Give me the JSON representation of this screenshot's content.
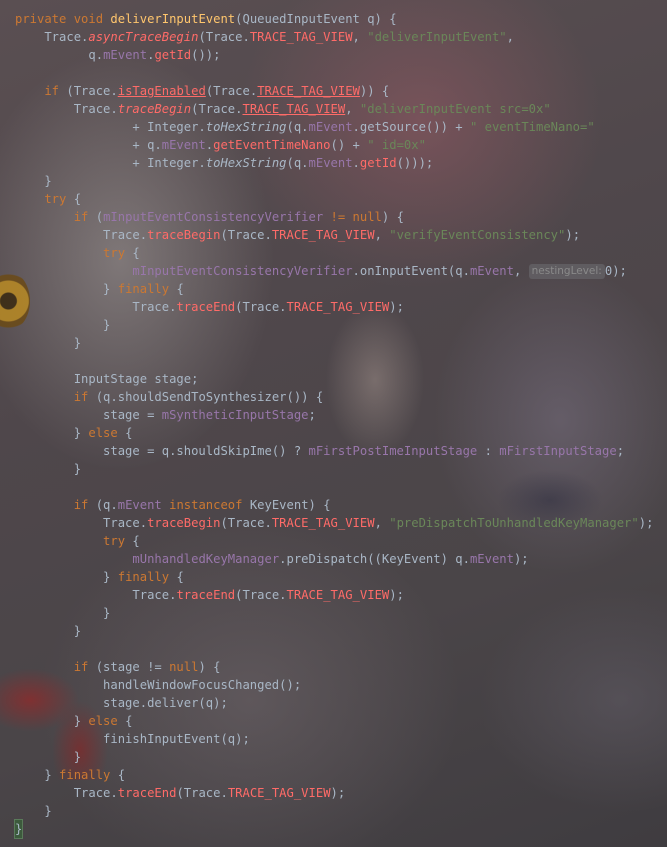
{
  "editor": {
    "language": "java",
    "theme_colors": {
      "default": "#a9b7c6",
      "keyword": "#cc7832",
      "method_declaration": "#ffc66d",
      "field": "#9876aa",
      "static_member": "#ff6b68",
      "string": "#6a8759",
      "inlay_hint": "#8a8a8a"
    },
    "lines": [
      [
        [
          "kw",
          "private void "
        ],
        [
          "mfn",
          "deliverInputEvent"
        ],
        [
          "",
          "(QueuedInputEvent q) {"
        ]
      ],
      [
        [
          "",
          "    Trace."
        ],
        [
          "sm it",
          "asyncTraceBegin"
        ],
        [
          "",
          "(Trace."
        ],
        [
          "sm",
          "TRACE_TAG_VIEW"
        ],
        [
          "",
          ", "
        ],
        [
          "str",
          "\"deliverInputEvent\""
        ],
        [
          "",
          ","
        ]
      ],
      [
        [
          "",
          "          q."
        ],
        [
          "fld",
          "mEvent"
        ],
        [
          "",
          "."
        ],
        [
          "sm",
          "getId"
        ],
        [
          "",
          "());"
        ]
      ],
      [
        [
          "",
          ""
        ]
      ],
      [
        [
          "kw",
          "    if "
        ],
        [
          "",
          "(Trace."
        ],
        [
          "sm ul",
          "isTagEnabled"
        ],
        [
          "",
          "(Trace."
        ],
        [
          "sm ul",
          "TRACE_TAG_VIEW"
        ],
        [
          "",
          ")) {"
        ]
      ],
      [
        [
          "",
          "        Trace."
        ],
        [
          "sm it",
          "traceBegin"
        ],
        [
          "",
          "(Trace."
        ],
        [
          "sm ul",
          "TRACE_TAG_VIEW"
        ],
        [
          "",
          ", "
        ],
        [
          "str",
          "\"deliverInputEvent src=0x\""
        ]
      ],
      [
        [
          "",
          "                + Integer."
        ],
        [
          "it",
          "toHexString"
        ],
        [
          "",
          "(q."
        ],
        [
          "fld",
          "mEvent"
        ],
        [
          "",
          ".getSource()) + "
        ],
        [
          "str",
          "\" eventTimeNano=\""
        ]
      ],
      [
        [
          "",
          "                + q."
        ],
        [
          "fld",
          "mEvent"
        ],
        [
          "",
          "."
        ],
        [
          "sm",
          "getEventTimeNano"
        ],
        [
          "",
          "() + "
        ],
        [
          "str",
          "\" id=0x\""
        ]
      ],
      [
        [
          "",
          "                + Integer."
        ],
        [
          "it",
          "toHexString"
        ],
        [
          "",
          "(q."
        ],
        [
          "fld",
          "mEvent"
        ],
        [
          "",
          "."
        ],
        [
          "sm",
          "getId"
        ],
        [
          "",
          "()));"
        ]
      ],
      [
        [
          "",
          "    }"
        ]
      ],
      [
        [
          "kw",
          "    try "
        ],
        [
          "",
          "{"
        ]
      ],
      [
        [
          "kw",
          "        if "
        ],
        [
          "",
          "("
        ],
        [
          "fld",
          "mInputEventConsistencyVerifier"
        ],
        [
          "",
          ""
        ],
        [
          "kw",
          " != null"
        ],
        [
          "",
          ") {"
        ]
      ],
      [
        [
          "",
          "            Trace."
        ],
        [
          "sm",
          "traceBegin"
        ],
        [
          "",
          "(Trace."
        ],
        [
          "sm",
          "TRACE_TAG_VIEW"
        ],
        [
          "",
          ", "
        ],
        [
          "str",
          "\"verifyEventConsistency\""
        ],
        [
          "",
          ");"
        ]
      ],
      [
        [
          "kw",
          "            try "
        ],
        [
          "",
          "{"
        ]
      ],
      [
        [
          "",
          "                "
        ],
        [
          "fld",
          "mInputEventConsistencyVerifier"
        ],
        [
          "",
          ".onInputEvent(q."
        ],
        [
          "fld",
          "mEvent"
        ],
        [
          "",
          ", "
        ],
        [
          "hint",
          "nestingLevel:"
        ],
        [
          "",
          "0);"
        ]
      ],
      [
        [
          "",
          "            } "
        ],
        [
          "kw",
          "finally "
        ],
        [
          "",
          "{"
        ]
      ],
      [
        [
          "",
          "                Trace."
        ],
        [
          "sm",
          "traceEnd"
        ],
        [
          "",
          "(Trace."
        ],
        [
          "sm",
          "TRACE_TAG_VIEW"
        ],
        [
          "",
          ");"
        ]
      ],
      [
        [
          "",
          "            }"
        ]
      ],
      [
        [
          "",
          "        }"
        ]
      ],
      [
        [
          "",
          ""
        ]
      ],
      [
        [
          "",
          "        InputStage stage;"
        ]
      ],
      [
        [
          "kw",
          "        if "
        ],
        [
          "",
          "(q.shouldSendToSynthesizer()) {"
        ]
      ],
      [
        [
          "",
          "            stage = "
        ],
        [
          "fld",
          "mSyntheticInputStage"
        ],
        [
          "",
          ";"
        ]
      ],
      [
        [
          "",
          "        } "
        ],
        [
          "kw",
          "else "
        ],
        [
          "",
          "{"
        ]
      ],
      [
        [
          "",
          "            stage = q.shouldSkipIme() ? "
        ],
        [
          "fld",
          "mFirstPostImeInputStage"
        ],
        [
          "",
          " : "
        ],
        [
          "fld",
          "mFirstInputStage"
        ],
        [
          "",
          ";"
        ]
      ],
      [
        [
          "",
          "        }"
        ]
      ],
      [
        [
          "",
          ""
        ]
      ],
      [
        [
          "kw",
          "        if "
        ],
        [
          "",
          "(q."
        ],
        [
          "fld",
          "mEvent"
        ],
        [
          "kw",
          " instanceof "
        ],
        [
          "",
          "KeyEvent) {"
        ]
      ],
      [
        [
          "",
          "            Trace."
        ],
        [
          "sm",
          "traceBegin"
        ],
        [
          "",
          "(Trace."
        ],
        [
          "sm",
          "TRACE_TAG_VIEW"
        ],
        [
          "",
          ", "
        ],
        [
          "str",
          "\"preDispatchToUnhandledKeyManager\""
        ],
        [
          "",
          ");"
        ]
      ],
      [
        [
          "kw",
          "            try "
        ],
        [
          "",
          "{"
        ]
      ],
      [
        [
          "",
          "                "
        ],
        [
          "fld",
          "mUnhandledKeyManager"
        ],
        [
          "",
          ".preDispatch((KeyEvent) q."
        ],
        [
          "fld",
          "mEvent"
        ],
        [
          "",
          ");"
        ]
      ],
      [
        [
          "",
          "            } "
        ],
        [
          "kw",
          "finally "
        ],
        [
          "",
          "{"
        ]
      ],
      [
        [
          "",
          "                Trace."
        ],
        [
          "sm",
          "traceEnd"
        ],
        [
          "",
          "(Trace."
        ],
        [
          "sm",
          "TRACE_TAG_VIEW"
        ],
        [
          "",
          ");"
        ]
      ],
      [
        [
          "",
          "            }"
        ]
      ],
      [
        [
          "",
          "        }"
        ]
      ],
      [
        [
          "",
          ""
        ]
      ],
      [
        [
          "kw",
          "        if "
        ],
        [
          "",
          "(stage != "
        ],
        [
          "kw",
          "null"
        ],
        [
          "",
          ") {"
        ]
      ],
      [
        [
          "",
          "            handleWindowFocusChanged();"
        ]
      ],
      [
        [
          "",
          "            stage.deliver(q);"
        ]
      ],
      [
        [
          "",
          "        } "
        ],
        [
          "kw",
          "else "
        ],
        [
          "",
          "{"
        ]
      ],
      [
        [
          "",
          "            finishInputEvent(q);"
        ]
      ],
      [
        [
          "",
          "        }"
        ]
      ],
      [
        [
          "",
          "    } "
        ],
        [
          "kw",
          "finally "
        ],
        [
          "",
          "{"
        ]
      ],
      [
        [
          "",
          "        Trace."
        ],
        [
          "sm",
          "traceEnd"
        ],
        [
          "",
          "(Trace."
        ],
        [
          "sm",
          "TRACE_TAG_VIEW"
        ],
        [
          "",
          ");"
        ]
      ],
      [
        [
          "",
          "    }"
        ]
      ],
      [
        [
          "caret",
          "}"
        ]
      ]
    ]
  }
}
